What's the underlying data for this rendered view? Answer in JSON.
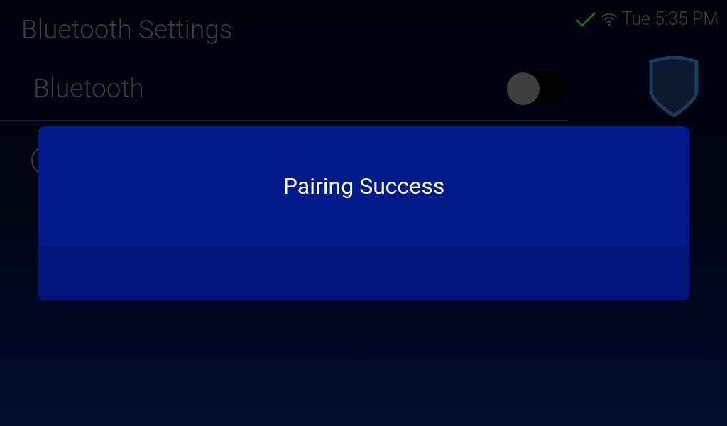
{
  "header": {
    "title": "Bluetooth Settings"
  },
  "status_bar": {
    "connected": true,
    "time": "Tue 5:35 PM"
  },
  "bluetooth_row": {
    "label": "Bluetooth",
    "on": false
  },
  "dialog": {
    "message": "Pairing Success"
  }
}
